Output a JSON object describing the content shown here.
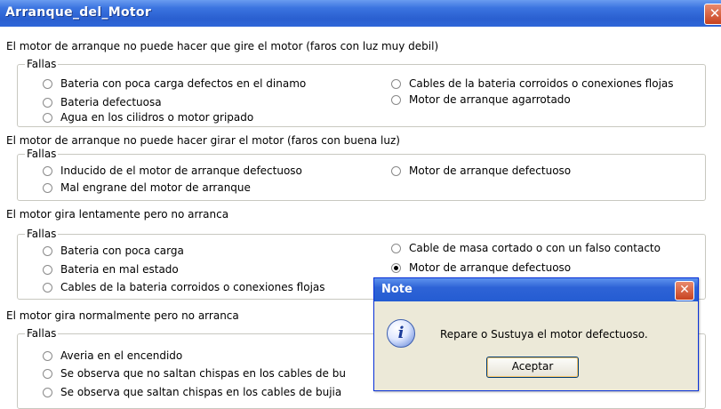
{
  "window": {
    "title": "Arranque_del_Motor",
    "close_glyph": "✕"
  },
  "sections": [
    {
      "title": "El motor de arranque no puede  hacer  que gire el motor (faros con luz muy debil)",
      "group_label": "Fallas",
      "options": [
        {
          "label": "Bateria con poca carga defectos en el dinamo",
          "checked": false
        },
        {
          "label": "Bateria defectuosa",
          "checked": false
        },
        {
          "label": "Agua en los cilidros o motor gripado",
          "checked": false
        },
        {
          "label": "Cables de la bateria corroidos o conexiones flojas",
          "checked": false
        },
        {
          "label": "Motor de arranque agarrotado",
          "checked": false
        }
      ]
    },
    {
      "title": "El motor de arranque no puede hacer girar el motor (faros con buena luz)",
      "group_label": "Fallas",
      "options": [
        {
          "label": "Inducido de el motor de arranque  defectuoso",
          "checked": false
        },
        {
          "label": "Mal engrane del motor de arranque",
          "checked": false
        },
        {
          "label": "Motor de arranque defectuoso",
          "checked": false
        }
      ]
    },
    {
      "title": "El motor gira lentamente pero no arranca",
      "group_label": "Fallas",
      "options": [
        {
          "label": "Bateria con poca carga",
          "checked": false
        },
        {
          "label": "Bateria en mal estado",
          "checked": false
        },
        {
          "label": "Cables de la bateria corroidos o conexiones flojas",
          "checked": false
        },
        {
          "label": "Cable de masa cortado o con un falso contacto",
          "checked": false
        },
        {
          "label": "Motor de arranque defectuoso",
          "checked": true
        }
      ]
    },
    {
      "title": "El motor gira normalmente pero no arranca",
      "group_label": "Fallas",
      "options": [
        {
          "label": "Averia en el encendido",
          "checked": false
        },
        {
          "label": "Se observa que no saltan chispas en los cables de bu",
          "checked": false
        },
        {
          "label": "Se observa que saltan chispas en los cables de bujia",
          "checked": false
        }
      ]
    }
  ],
  "dialog": {
    "title": "Note",
    "close_glyph": "✕",
    "icon": "info-icon",
    "icon_glyph": "i",
    "message": "Repare o Sustuya el motor defectuoso.",
    "ok_label": "Aceptar"
  }
}
